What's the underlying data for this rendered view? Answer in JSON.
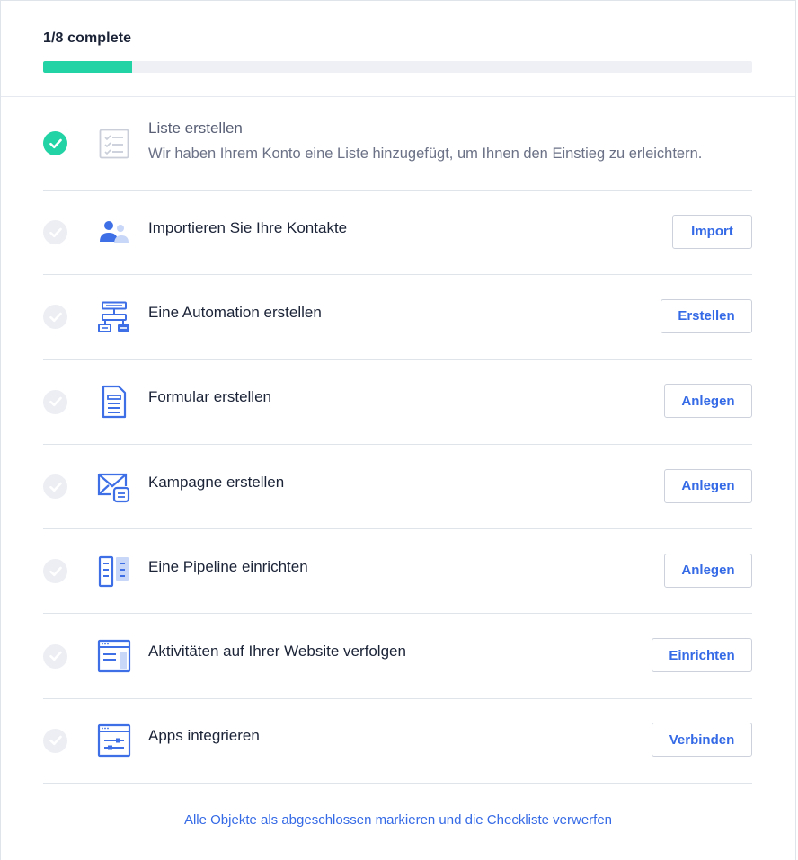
{
  "progress": {
    "label": "1/8 complete",
    "completed": 1,
    "total": 8,
    "fraction": 0.125,
    "fill_color": "#22d3a5"
  },
  "items": [
    {
      "title": "Liste erstellen",
      "description": "Wir haben Ihrem Konto eine Liste hinzugefügt, um Ihnen den Einstieg zu erleichtern.",
      "done": true,
      "icon": "checklist-icon"
    },
    {
      "title": "Importieren Sie Ihre Kontakte",
      "button": "Import",
      "done": false,
      "icon": "contacts-icon"
    },
    {
      "title": "Eine Automation erstellen",
      "button": "Erstellen",
      "done": false,
      "icon": "automation-icon"
    },
    {
      "title": "Formular erstellen",
      "button": "Anlegen",
      "done": false,
      "icon": "form-icon"
    },
    {
      "title": "Kampagne erstellen",
      "button": "Anlegen",
      "done": false,
      "icon": "campaign-icon"
    },
    {
      "title": "Eine Pipeline einrichten",
      "button": "Anlegen",
      "done": false,
      "icon": "pipeline-icon"
    },
    {
      "title": "Aktivitäten auf Ihrer Website verfolgen",
      "button": "Einrichten",
      "done": false,
      "icon": "website-tracking-icon"
    },
    {
      "title": "Apps integrieren",
      "button": "Verbinden",
      "done": false,
      "icon": "apps-integration-icon"
    }
  ],
  "footer": {
    "link": "Alle Objekte als abgeschlossen markieren und die Checkliste verwerfen"
  },
  "colors": {
    "accent": "#356ae6",
    "success": "#22d3a5"
  }
}
